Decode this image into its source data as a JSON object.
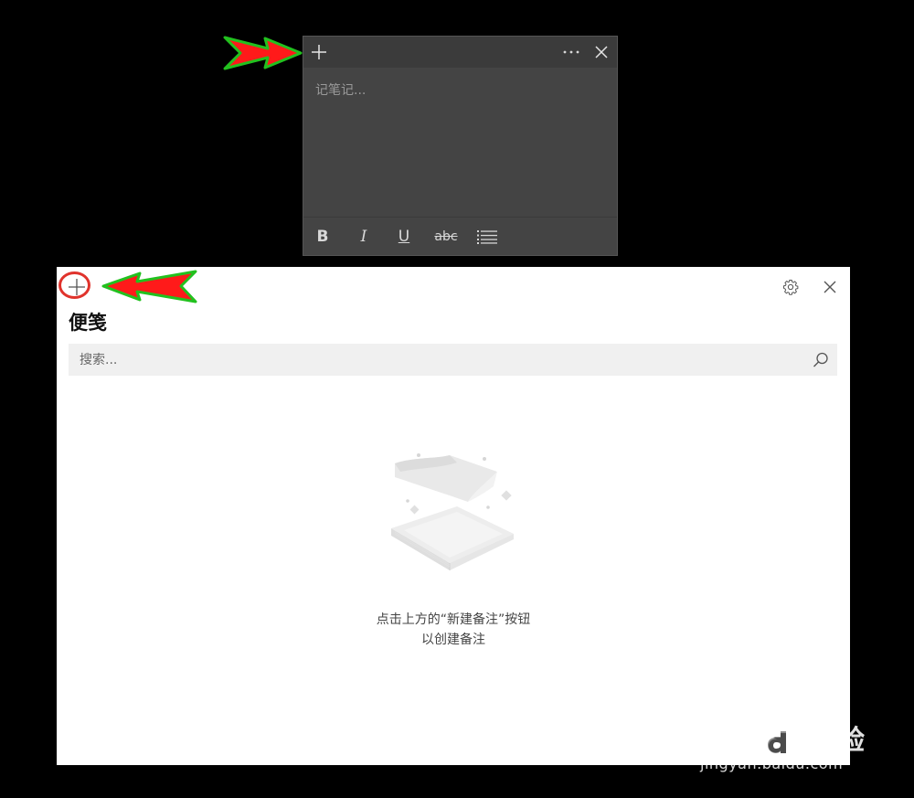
{
  "sticky_note": {
    "placeholder": "记笔记...",
    "toolbar": {
      "bold": "B",
      "italic": "I",
      "underline": "U",
      "strikethrough": "abc"
    }
  },
  "notes_list": {
    "title": "便笺",
    "search_placeholder": "搜索...",
    "empty_line1": "点击上方的“新建备注”按钮",
    "empty_line2": "以创建备注"
  },
  "watermark": {
    "logo_text": "Baidu经验",
    "url": "jingyan.baidu.com"
  },
  "colors": {
    "note_bg": "#444444",
    "note_titlebar": "#3b3b3b",
    "window_bg": "#ffffff",
    "search_bg": "#f0f0f0",
    "arrow_fill": "#ff1a1a",
    "arrow_outline": "#22c11f",
    "circle_mark": "#e0332c"
  }
}
